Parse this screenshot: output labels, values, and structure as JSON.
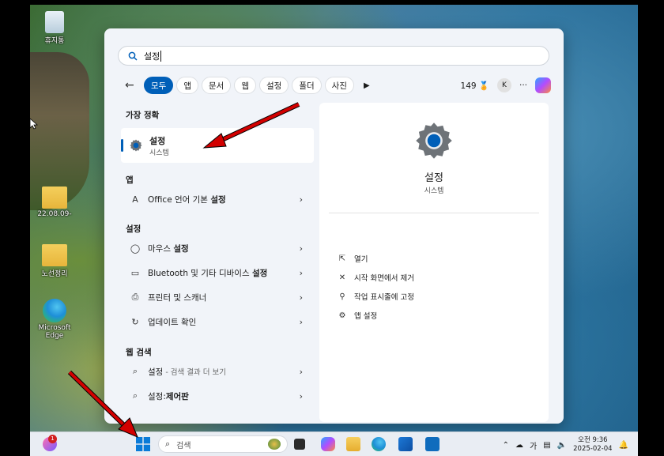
{
  "desktop": {
    "icons": [
      {
        "label": "휴지통"
      },
      {
        "label": "22.08.09-"
      },
      {
        "label": "노선정리"
      },
      {
        "label": "Microsoft Edge"
      }
    ]
  },
  "search": {
    "query": "설정",
    "filters": [
      "모두",
      "앱",
      "문서",
      "웹",
      "설정",
      "폴더",
      "사진"
    ],
    "count": "149",
    "avatar_initial": "K",
    "more": "···"
  },
  "results": {
    "best_match_header": "가장 정확",
    "best_match": {
      "title": "설정",
      "subtitle": "시스템"
    },
    "apps_header": "앱",
    "apps": [
      {
        "prefix": "Office 언어 기본 ",
        "bold": "설정"
      }
    ],
    "settings_header": "설정",
    "settings": [
      {
        "prefix": "마우스 ",
        "bold": "설정"
      },
      {
        "prefix": "Bluetooth 및 기타 디바이스 ",
        "bold": "설정"
      },
      {
        "prefix": "프린터 및 스캐너",
        "bold": ""
      },
      {
        "prefix": "업데이트 확인",
        "bold": ""
      }
    ],
    "web_header": "웹 검색",
    "web": [
      {
        "prefix": "설정",
        "muted": " - 검색 결과 더 보기"
      },
      {
        "prefix": "설정:",
        "bold": "제어판"
      }
    ]
  },
  "detail": {
    "title": "설정",
    "subtitle": "시스템",
    "actions": [
      "열기",
      "시작 화면에서 제거",
      "작업 표시줄에 고정",
      "앱 설정"
    ]
  },
  "taskbar": {
    "search_placeholder": "검색",
    "badge": "1",
    "ime": "가",
    "time": "오전 9:36",
    "date": "2025-02-04"
  },
  "colors": {
    "accent": "#005fb8",
    "arrow": "#d20000"
  }
}
